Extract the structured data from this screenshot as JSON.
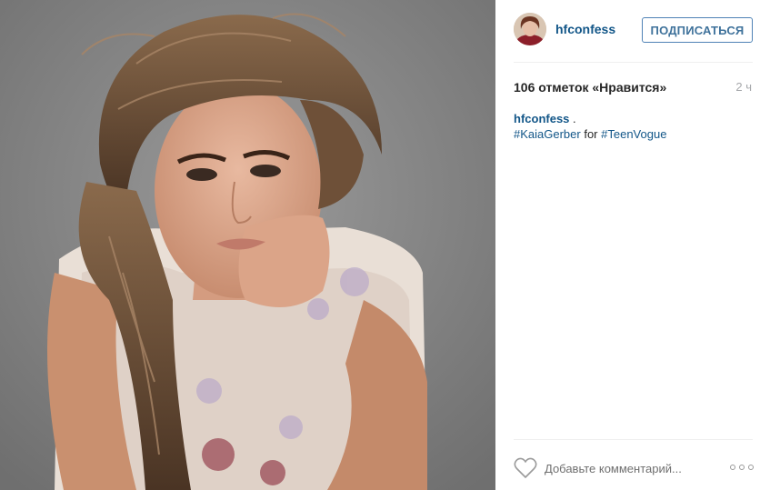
{
  "post": {
    "photo": {
      "subject": "portrait",
      "background_color": "#8f8f8f"
    },
    "header": {
      "username": "hfconfess",
      "follow_label": "ПОДПИСАТЬСЯ"
    },
    "likes_text": "106 отметок «Нравится»",
    "time_ago": "2 ч",
    "caption": {
      "author": "hfconfess",
      "author_suffix": " .",
      "hashtag_1": "#KaiaGerber",
      "connector": " for ",
      "hashtag_2": "#TeenVogue"
    },
    "footer": {
      "like_icon": "heart-outline-icon",
      "comment_placeholder": "Добавьте комментарий...",
      "more_icon": "ellipsis-icon"
    }
  },
  "colors": {
    "link": "#125688",
    "button_text": "#3f729b",
    "button_border": "#4f82b5",
    "muted": "#a5a7aa"
  }
}
